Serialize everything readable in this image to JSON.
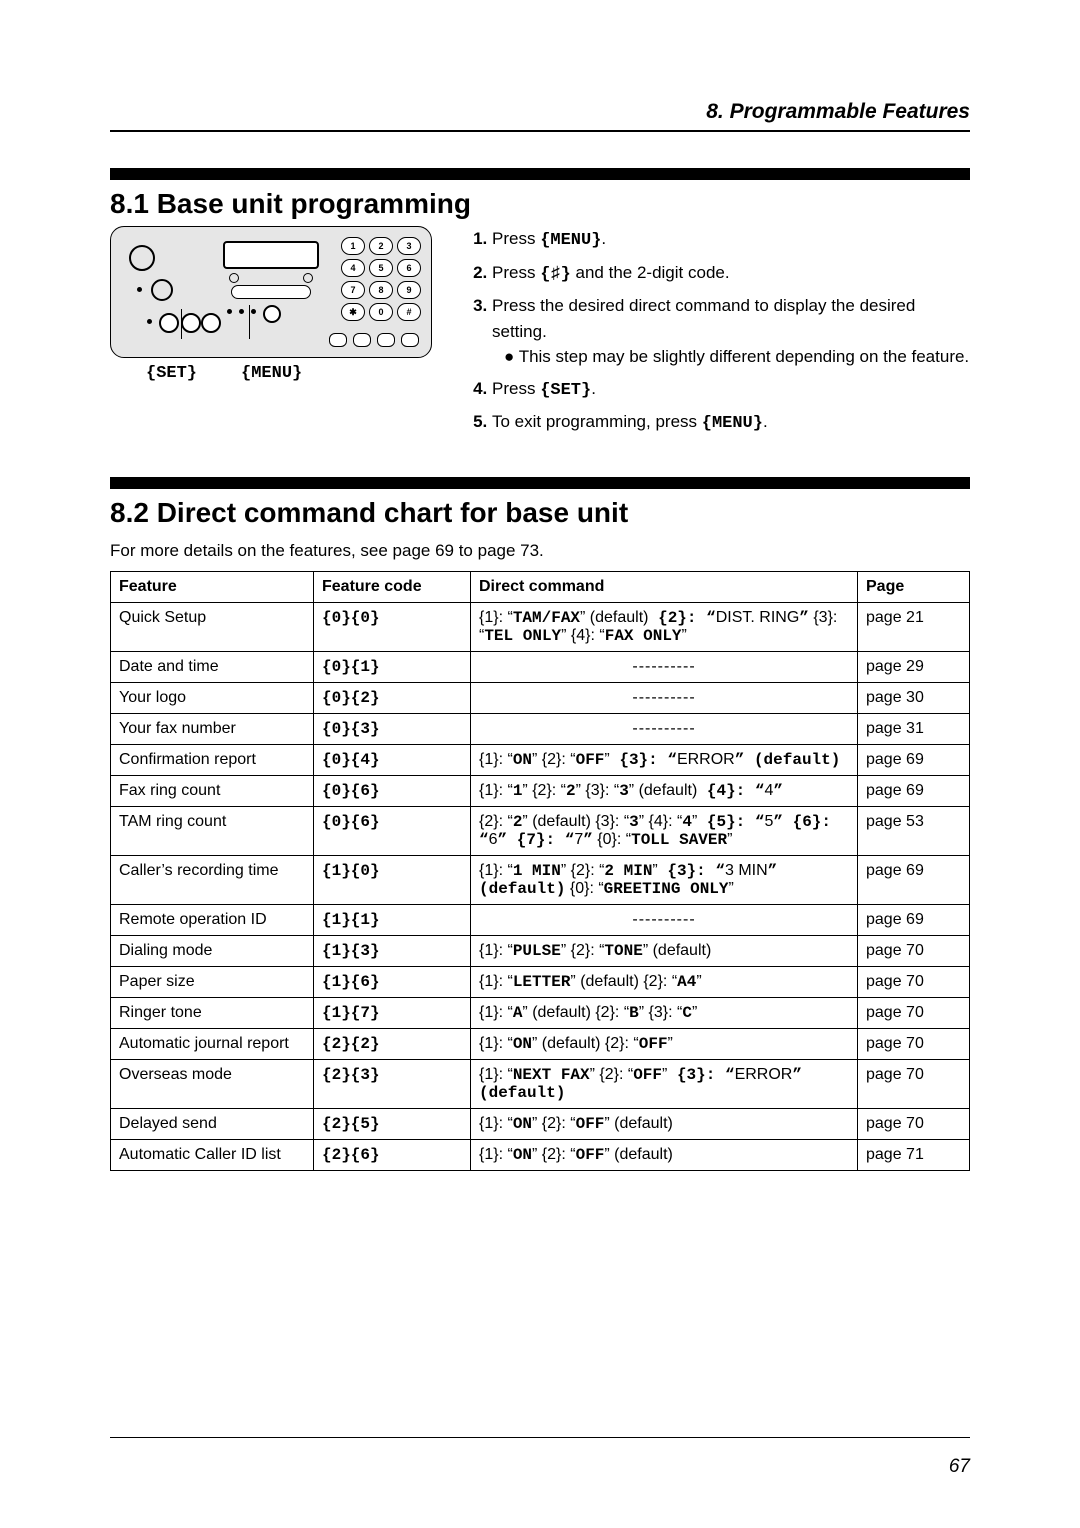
{
  "header": {
    "chapter": "8. Programmable Features"
  },
  "section1": {
    "heading": "8.1 Base unit programming",
    "buttons": {
      "set": "{SET}",
      "menu": "{MENU}"
    },
    "steps": [
      {
        "prefix": "Press ",
        "key": "{MENU}",
        "suffix": "."
      },
      {
        "prefix": "Press ",
        "key": "{♯}",
        "suffix": " and the 2-digit code."
      },
      {
        "prefix": "Press the desired direct command to display the desired setting.",
        "bullet_prefix": "● ",
        "bullet": "This step may be slightly different depending on the feature."
      },
      {
        "prefix": "Press ",
        "key": "{SET}",
        "suffix": "."
      },
      {
        "prefix": "To exit programming, press ",
        "key": "{MENU}",
        "suffix": "."
      }
    ]
  },
  "keypad": [
    "1",
    "2",
    "3",
    "4",
    "5",
    "6",
    "7",
    "8",
    "9",
    "✱",
    "0",
    "#"
  ],
  "section2": {
    "heading": "8.2 Direct command chart for base unit",
    "subnote": "For more details on the features, see page 69 to page 73."
  },
  "table": {
    "headers": {
      "feature": "Feature",
      "code": "Feature code",
      "cmd": "Direct command",
      "page": "Page"
    },
    "rows": [
      {
        "feature": "Quick Setup",
        "code": "{0}{0}",
        "cmd_parts": [
          "{1}: “",
          "TAM/FAX",
          "” (default)",
          " {2}: “",
          "DIST. RING",
          "”",
          " {3}: “",
          "TEL ONLY",
          "” {4}: “",
          "FAX ONLY",
          "”"
        ],
        "page": "page 21"
      },
      {
        "feature": "Date and time",
        "code": "{0}{1}",
        "cmd_dashes": "----------",
        "page": "page 29"
      },
      {
        "feature": "Your logo",
        "code": "{0}{2}",
        "cmd_dashes": "----------",
        "page": "page 30"
      },
      {
        "feature": "Your fax number",
        "code": "{0}{3}",
        "cmd_dashes": "----------",
        "page": "page 31"
      },
      {
        "feature": "Confirmation report",
        "code": "{0}{4}",
        "cmd_parts": [
          "{1}: “",
          "ON",
          "” {2}: “",
          "OFF",
          "”",
          " {3}: “",
          "ERROR",
          "” (default)"
        ],
        "page": "page 69"
      },
      {
        "feature": "Fax ring count",
        "code": "{0}{6}",
        "cmd_parts": [
          "{1}: “",
          "1",
          "” {2}: “",
          "2",
          "” {3}: “",
          "3",
          "” (default)",
          " {4}: “",
          "4",
          "”"
        ],
        "page": "page 69"
      },
      {
        "feature": "TAM ring count",
        "code": "{0}{6}",
        "cmd_parts": [
          "{2}: “",
          "2",
          "” (default) {3}: “",
          "3",
          "” {4}: “",
          "4",
          "”",
          " {5}: “",
          "5",
          "” {6}: “",
          "6",
          "” {7}: “",
          "7",
          "”",
          " {0}: “",
          "TOLL SAVER",
          "”"
        ],
        "page": "page 53"
      },
      {
        "feature": "Caller’s recording time",
        "code": "{1}{0}",
        "cmd_parts": [
          "{1}: “",
          "1 MIN",
          "” {2}: “",
          "2 MIN",
          "”",
          " {3}: “",
          "3 MIN",
          "” (default)",
          " {0}: “",
          "GREETING ONLY",
          "”"
        ],
        "page": "page 69"
      },
      {
        "feature": "Remote operation ID",
        "code": "{1}{1}",
        "cmd_dashes": "----------",
        "page": "page 69"
      },
      {
        "feature": "Dialing mode",
        "code": "{1}{3}",
        "cmd_parts": [
          "{1}: “",
          "PULSE",
          "” {2}: “",
          "TONE",
          "” (default)"
        ],
        "page": "page 70"
      },
      {
        "feature": "Paper size",
        "code": "{1}{6}",
        "cmd_parts": [
          "{1}: “",
          "LETTER",
          "” (default) {2}: “",
          "A4",
          "”"
        ],
        "page": "page 70"
      },
      {
        "feature": "Ringer tone",
        "code": "{1}{7}",
        "cmd_parts": [
          "{1}: “",
          "A",
          "” (default) {2}: “",
          "B",
          "” {3}: “",
          "C",
          "”"
        ],
        "page": "page 70"
      },
      {
        "feature": "Automatic journal report",
        "code": "{2}{2}",
        "cmd_parts": [
          "{1}: “",
          "ON",
          "” (default) {2}: “",
          "OFF",
          "”"
        ],
        "page": "page 70"
      },
      {
        "feature": "Overseas mode",
        "code": "{2}{3}",
        "cmd_parts": [
          "{1}: “",
          "NEXT FAX",
          "” {2}: “",
          "OFF",
          "”",
          " {3}: “",
          "ERROR",
          "” (default)"
        ],
        "page": "page 70"
      },
      {
        "feature": "Delayed send",
        "code": "{2}{5}",
        "cmd_parts": [
          "{1}: “",
          "ON",
          "” {2}: “",
          "OFF",
          "” (default)"
        ],
        "page": "page 70"
      },
      {
        "feature": "Automatic Caller ID list",
        "code": "{2}{6}",
        "cmd_parts": [
          "{1}: “",
          "ON",
          "” {2}: “",
          "OFF",
          "” (default)"
        ],
        "page": "page 71"
      }
    ]
  },
  "pagenum": "67"
}
